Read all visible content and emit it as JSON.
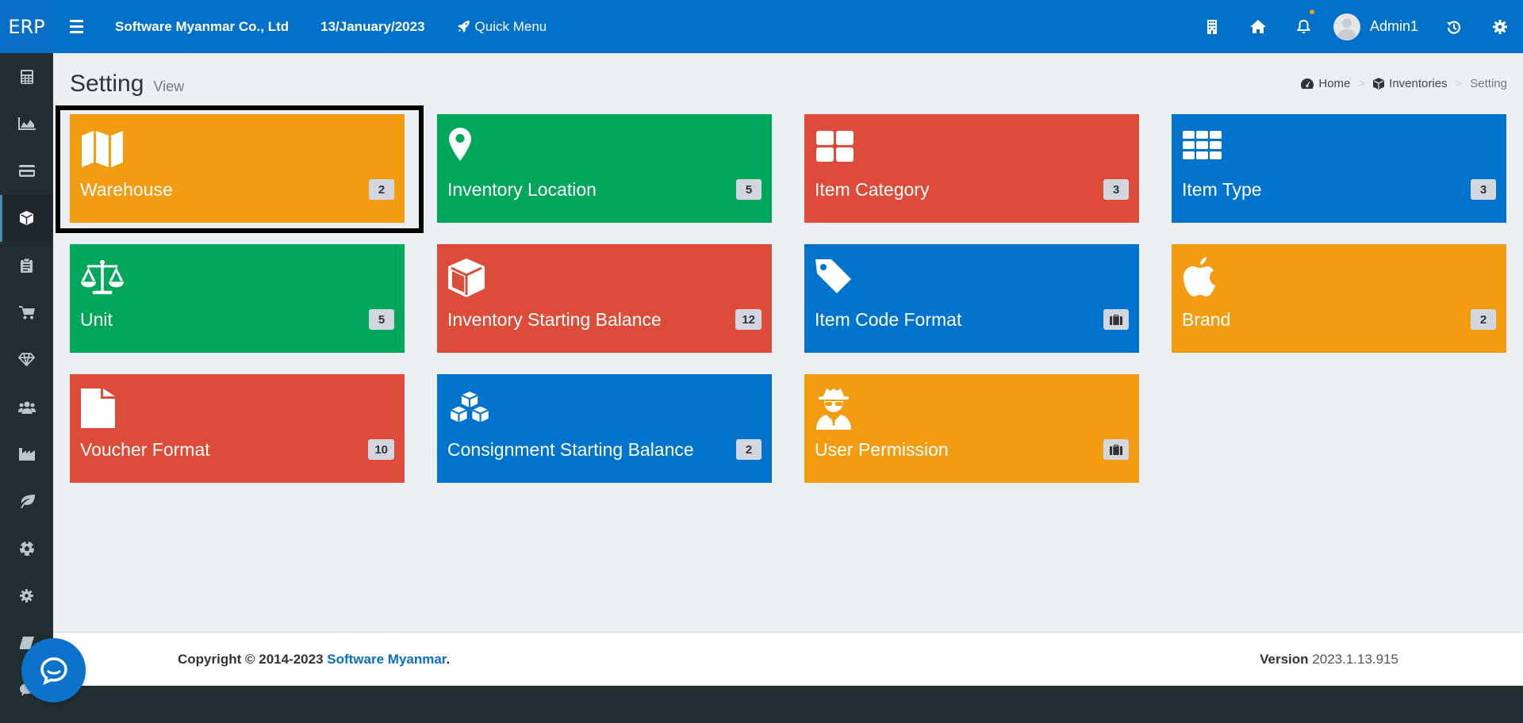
{
  "app": {
    "logo": "ERP"
  },
  "topbar": {
    "company": "Software Myanmar Co., Ltd",
    "date": "13/January/2023",
    "quick_menu": "Quick Menu",
    "user_name": "Admin1"
  },
  "sidebar": {
    "items": [
      {
        "icon": "calculator-icon"
      },
      {
        "icon": "area-chart-icon"
      },
      {
        "icon": "credit-card-icon"
      },
      {
        "icon": "cube-icon",
        "active": true
      },
      {
        "icon": "clipboard-icon"
      },
      {
        "icon": "cart-icon"
      },
      {
        "icon": "diamond-icon"
      },
      {
        "icon": "users-icon"
      },
      {
        "icon": "industry-icon"
      },
      {
        "icon": "leaf-icon"
      },
      {
        "icon": "soccer-ball-icon"
      },
      {
        "icon": "gear-icon"
      },
      {
        "icon": "book-icon"
      },
      {
        "icon": "comment-icon"
      }
    ]
  },
  "page": {
    "title": "Setting",
    "subtitle": "View",
    "breadcrumb": {
      "home": "Home",
      "inventories": "Inventories",
      "current": "Setting",
      "separator": ">"
    }
  },
  "tiles": [
    {
      "label": "Warehouse",
      "badge": "2",
      "color": "#f39c12",
      "icon": "map-icon"
    },
    {
      "label": "Inventory Location",
      "badge": "5",
      "color": "#00a65a",
      "icon": "map-marker-icon"
    },
    {
      "label": "Item Category",
      "badge": "3",
      "color": "#dd4b39",
      "icon": "th-large-icon"
    },
    {
      "label": "Item Type",
      "badge": "3",
      "color": "#0073cc",
      "icon": "th-icon"
    },
    {
      "label": "Unit",
      "badge": "5",
      "color": "#00a65a",
      "icon": "balance-scale-icon"
    },
    {
      "label": "Inventory Starting Balance",
      "badge": "12",
      "color": "#dd4b39",
      "icon": "cube-icon"
    },
    {
      "label": "Item Code Format",
      "badge": "",
      "color": "#0073cc",
      "icon": "tag-icon"
    },
    {
      "label": "Brand",
      "badge": "2",
      "color": "#f39c12",
      "icon": "apple-icon"
    },
    {
      "label": "Voucher Format",
      "badge": "10",
      "color": "#dd4b39",
      "icon": "file-icon"
    },
    {
      "label": "Consignment Starting Balance",
      "badge": "2",
      "color": "#0073cc",
      "icon": "cubes-icon"
    },
    {
      "label": "User Permission",
      "badge": "",
      "color": "#f39c12",
      "icon": "user-secret-icon"
    }
  ],
  "footer": {
    "copyright_prefix": "Copyright © 2014-2023 ",
    "company_link": "Software Myanmar",
    "suffix": ".",
    "version_label": "Version",
    "version": "2023.1.13.915"
  }
}
